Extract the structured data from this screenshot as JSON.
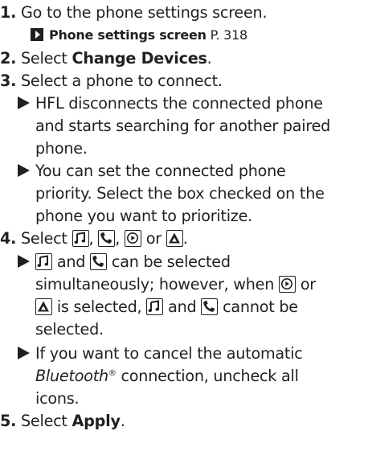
{
  "steps": [
    {
      "num": "1.",
      "text": "Go to the phone settings screen."
    },
    {
      "num": "2.",
      "pre": "Select ",
      "bold": "Change Devices",
      "post": "."
    },
    {
      "num": "3.",
      "text": "Select a phone to connect."
    },
    {
      "num": "4.",
      "pre": "Select ",
      "sep1": ", ",
      "sep2": ", ",
      "sep3": " or ",
      "post": "."
    },
    {
      "num": "5.",
      "pre": "Select ",
      "bold": "Apply",
      "post": "."
    }
  ],
  "reference": {
    "bold": "Phone settings screen",
    "page": " P. 318"
  },
  "step3_bullets": [
    [
      "HFL disconnects the connected phone",
      "and starts searching for another paired",
      "phone."
    ],
    [
      "You can set the connected phone",
      "priority. Select the box checked on the",
      "phone you want to prioritize."
    ]
  ],
  "step4_bullet1": {
    "l1_and": " and ",
    "l1_rest": " can be selected",
    "l2": "simultaneously; however, when ",
    "l2_or": " or",
    "l3_a": " is selected, ",
    "l3_and": " and ",
    "l3_b": " cannot be",
    "l4": "selected."
  },
  "step4_bullet2": {
    "l1": "If you want to cancel the automatic",
    "l2_italic": "Bluetooth",
    "l2_reg": "®",
    "l2_rest": " connection, uncheck all",
    "l3": "icons."
  },
  "icons": [
    "music-icon",
    "phone-icon",
    "carplay-icon",
    "android-auto-icon"
  ]
}
